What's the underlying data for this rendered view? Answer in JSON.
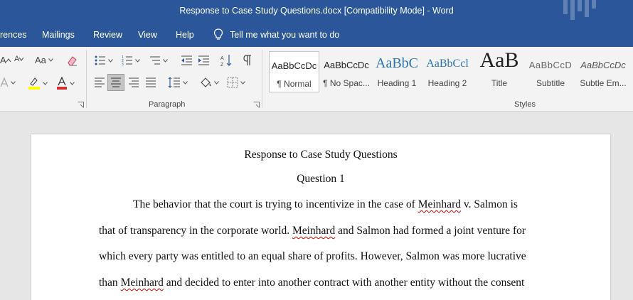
{
  "window": {
    "title": "Response to Case Study Questions.docx [Compatibility Mode]  -  Word"
  },
  "tabs": {
    "references": "rences",
    "mailings": "Mailings",
    "review": "Review",
    "view": "View",
    "help": "Help",
    "tell_me": "Tell me what you want to do"
  },
  "ribbon": {
    "font_size_up": "A",
    "font_size_down": "A",
    "change_case": "Aa",
    "paragraph_label": "Paragraph",
    "styles_label": "Styles",
    "styles": [
      {
        "sample": "AaBbCcDc",
        "name": "¶ Normal"
      },
      {
        "sample": "AaBbCcDc",
        "name": "¶ No Spac..."
      },
      {
        "sample": "AaBbC",
        "name": "Heading 1"
      },
      {
        "sample": "AaBbCcl",
        "name": "Heading 2"
      },
      {
        "sample": "AaB",
        "name": "Title"
      },
      {
        "sample": "AaBbCcD",
        "name": "Subtitle"
      },
      {
        "sample": "AaBbCcDc",
        "name": "Subtle Em..."
      }
    ]
  },
  "document": {
    "title": "Response to Case Study Questions",
    "subtitle": "Question 1",
    "lines": {
      "l1_pre": "The behavior that the court is trying to incentivize in the case of ",
      "l1_mis": "Meinhard",
      "l1_post": " v. Salmon is",
      "l2_pre": "that of transparency in the corporate world. ",
      "l2_mis": "Meinhard",
      "l2_post": " and Salmon had formed a joint venture for",
      "l3": "which every party was entitled to an equal share of profits. However, Salmon was more lucrative",
      "l4_pre": "than ",
      "l4_mis": "Meinhard",
      "l4_post": " and decided to enter into another contract with another entity without the consent"
    }
  },
  "colors": {
    "brand": "#2b579a",
    "ribbon_bg": "#f3f3f3",
    "doc_bg": "#e6e6e6",
    "spell_error": "#d00000"
  }
}
